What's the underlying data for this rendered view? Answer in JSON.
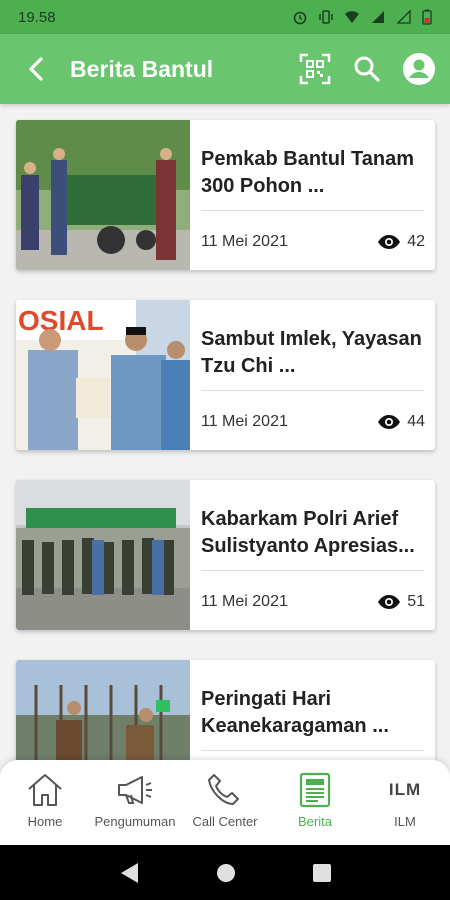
{
  "status_bar": {
    "time": "19.58"
  },
  "app_bar": {
    "title": "Berita Bantul"
  },
  "articles": [
    {
      "title": "Pemkab Bantul Tanam 300 Pohon ...",
      "date": "11 Mei 2021",
      "views": "42"
    },
    {
      "title": "Sambut Imlek, Yayasan Tzu Chi ...",
      "date": "11 Mei 2021",
      "views": "44"
    },
    {
      "title": "Kabarkam Polri Arief Sulistyanto Apresias...",
      "date": "11 Mei 2021",
      "views": "51"
    },
    {
      "title": "Peringati Hari Keanekaragaman ...",
      "date": "",
      "views": ""
    }
  ],
  "bottom_nav": {
    "items": [
      {
        "label": "Home",
        "icon": "home-icon"
      },
      {
        "label": "Pengumuman",
        "icon": "megaphone-icon"
      },
      {
        "label": "Call Center",
        "icon": "phone-icon"
      },
      {
        "label": "Berita",
        "icon": "newspaper-icon"
      },
      {
        "label": "ILM",
        "icon": "ilm-icon",
        "icon_text": "ILM"
      }
    ],
    "active": "Berita"
  },
  "colors": {
    "primary": "#6ac56f",
    "status": "#4caf50",
    "active": "#4caf50"
  }
}
